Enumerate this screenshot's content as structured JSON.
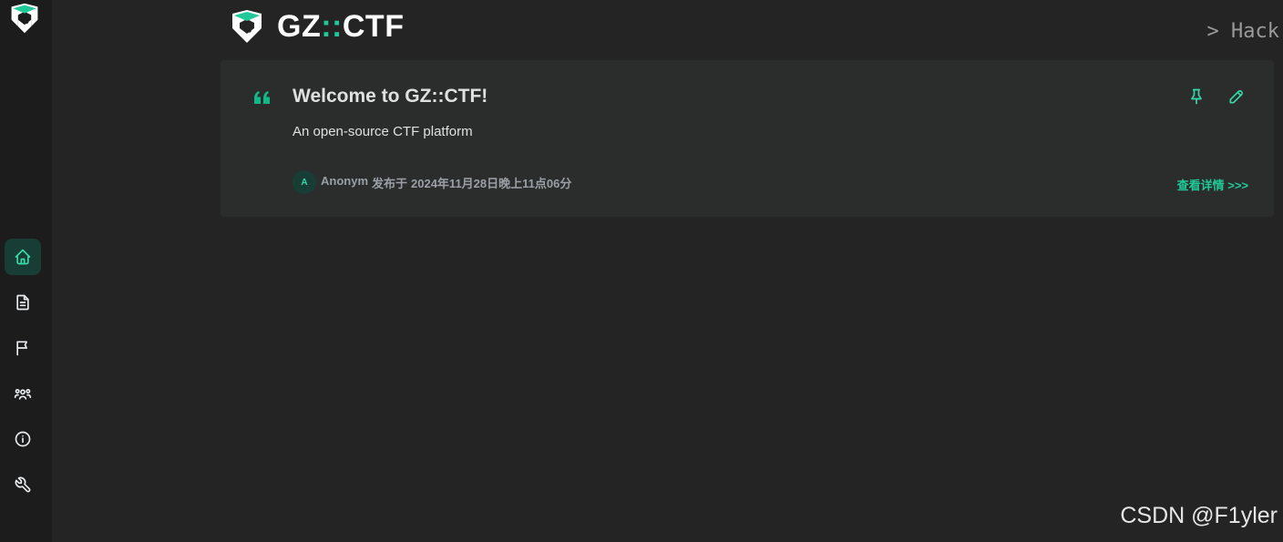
{
  "app": {
    "brand_prefix": "GZ",
    "brand_separator": "::",
    "brand_suffix": "CTF",
    "tagline": "> Hack"
  },
  "nav": {
    "items": [
      {
        "name": "home",
        "icon": "home-icon",
        "active": true
      },
      {
        "name": "posts",
        "icon": "file-text-icon",
        "active": false
      },
      {
        "name": "games",
        "icon": "flag-icon",
        "active": false
      },
      {
        "name": "teams",
        "icon": "users-icon",
        "active": false
      },
      {
        "name": "about",
        "icon": "info-icon",
        "active": false
      },
      {
        "name": "admin",
        "icon": "wrench-icon",
        "active": false
      }
    ]
  },
  "post": {
    "title": "Welcome to GZ::CTF!",
    "summary": "An open-source CTF platform",
    "author_initial": "A",
    "author": "Anonym",
    "published_prefix": "发布于",
    "published_time": "2024年11月28日晚上11点06分",
    "details_label": "查看详情 >>>",
    "pinned_icon": "pin-icon",
    "edit_icon": "pencil-icon"
  },
  "watermark": "CSDN @F1yler",
  "colors": {
    "accent": "#20c997",
    "accent_light": "#38d9a9",
    "background": "#242424",
    "sidebar": "#1c1c1c",
    "card": "#2b2d2d"
  }
}
